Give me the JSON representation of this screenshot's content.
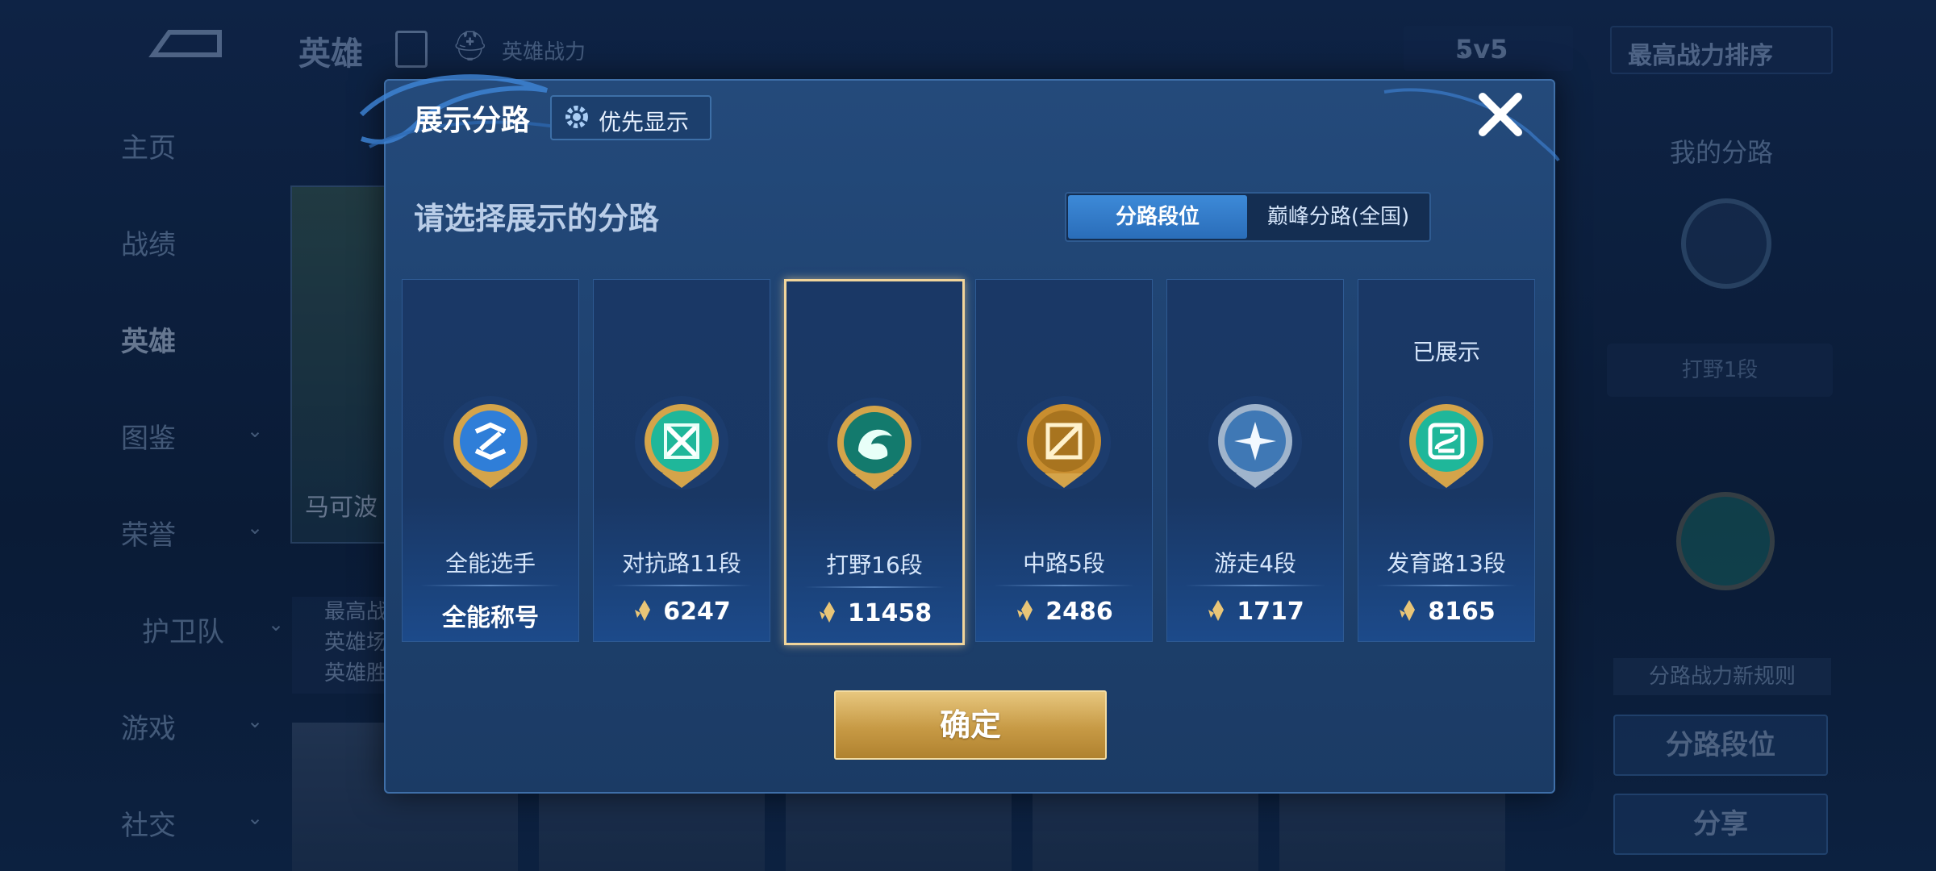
{
  "header": {
    "title": "英雄",
    "power_label": "英雄战力",
    "mode": "5v5",
    "sort": "最高战力排序"
  },
  "sidebar": {
    "items": [
      {
        "label": "主页"
      },
      {
        "label": "战绩"
      },
      {
        "label": "英雄"
      },
      {
        "label": "图鉴"
      },
      {
        "label": "荣誉"
      },
      {
        "label": "护卫队"
      },
      {
        "label": "游戏"
      },
      {
        "label": "社交"
      }
    ]
  },
  "hero": {
    "name": "马可波",
    "stats": [
      "最高战",
      "英雄场",
      "英雄胜"
    ]
  },
  "right_panel": {
    "my_lane_label": "我的分路",
    "my_lane_rank": "打野1段",
    "rule_label": "分路战力新规则",
    "lane_rank_button": "分路段位",
    "share_button": "分享"
  },
  "modal": {
    "title": "展示分路",
    "priority_button": "优先显示",
    "prompt": "请选择展示的分路",
    "toggle": {
      "a": "分路段位",
      "b": "巅峰分路(全国)"
    },
    "lanes": [
      {
        "name": "全能选手",
        "value": "全能称号",
        "shown": ""
      },
      {
        "name": "对抗路11段",
        "value": "6247",
        "shown": ""
      },
      {
        "name": "打野16段",
        "value": "11458",
        "shown": ""
      },
      {
        "name": "中路5段",
        "value": "2486",
        "shown": ""
      },
      {
        "name": "游走4段",
        "value": "1717",
        "shown": ""
      },
      {
        "name": "发育路13段",
        "value": "8165",
        "shown": "已展示"
      }
    ],
    "confirm": "确定"
  },
  "colors": {
    "accent_gold": "#f1d59b",
    "accent_blue": "#3d8ad8"
  }
}
